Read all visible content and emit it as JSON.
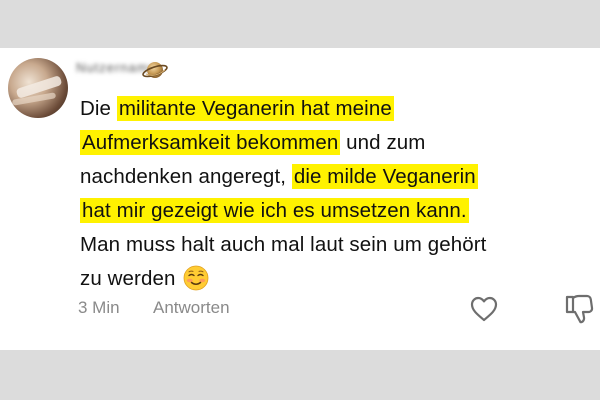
{
  "comment": {
    "author": "Nutzername",
    "lines": [
      [
        {
          "t": "Die ",
          "h": false
        },
        {
          "t": "militante Veganerin hat meine",
          "h": true
        }
      ],
      [
        {
          "t": "Aufmerksamkeit bekommen",
          "h": true
        },
        {
          "t": " und zum",
          "h": false
        }
      ],
      [
        {
          "t": "nachdenken angeregt, ",
          "h": false
        },
        {
          "t": "die milde Veganerin",
          "h": true
        }
      ],
      [
        {
          "t": "hat mir gezeigt wie ich es umsetzen kann.",
          "h": true
        }
      ],
      [
        {
          "t": "Man muss halt auch mal laut sein um gehört",
          "h": false
        }
      ],
      [
        {
          "t": "zu werden ",
          "h": false
        }
      ]
    ],
    "emoji": "smiling-face-with-blush-icon",
    "highlight_color": "#fff200"
  },
  "meta": {
    "time": "3 Min",
    "reply_label": "Antworten"
  },
  "icons": {
    "badge": "planet-icon",
    "like": "heart-outline-icon",
    "dislike": "thumbs-down-icon"
  }
}
